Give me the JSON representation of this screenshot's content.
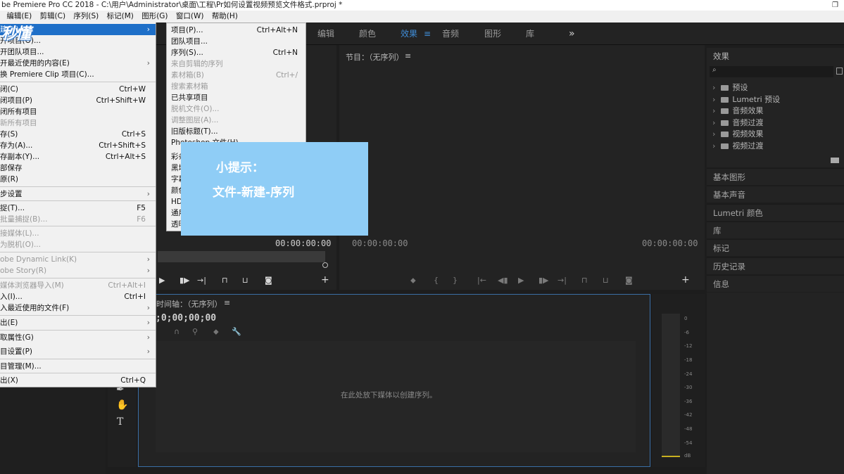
{
  "window": {
    "title": "be Premiere Pro CC 2018 - C:\\用户\\Administrator\\桌面\\工程\\Pr如何设置视频预览文件格式.prproj *",
    "restore_glyph": "❐"
  },
  "menubar": {
    "items": [
      "编辑(E)",
      "剪辑(C)",
      "序列(S)",
      "标记(M)",
      "图形(G)",
      "窗口(W)",
      "帮助(H)"
    ]
  },
  "logo_text": "秒懂",
  "workspaces": {
    "tabs": [
      "编辑",
      "颜色",
      "效果",
      "音频",
      "图形",
      "库"
    ],
    "active": "效果",
    "more_glyph": "»",
    "active_menu_glyph": "≡"
  },
  "file_menu": {
    "items": [
      {
        "label": "建(N)",
        "shortcut": "",
        "arrow": true,
        "disabled": false
      },
      {
        "label": "开项目(O)...",
        "shortcut": "",
        "arrow": false,
        "disabled": false
      },
      {
        "label": "开团队项目...",
        "shortcut": "",
        "arrow": false,
        "disabled": false
      },
      {
        "label": "开最近使用的内容(E)",
        "shortcut": "",
        "arrow": true,
        "disabled": false
      },
      {
        "label": "换 Premiere Clip 项目(C)...",
        "shortcut": "",
        "arrow": false,
        "disabled": false
      },
      {
        "label": "闭(C)",
        "shortcut": "Ctrl+W",
        "arrow": false,
        "disabled": false
      },
      {
        "label": "闭项目(P)",
        "shortcut": "Ctrl+Shift+W",
        "arrow": false,
        "disabled": false
      },
      {
        "label": "闭所有项目",
        "shortcut": "",
        "arrow": false,
        "disabled": false
      },
      {
        "label": "新所有项目",
        "shortcut": "",
        "arrow": false,
        "disabled": true
      },
      {
        "label": "存(S)",
        "shortcut": "Ctrl+S",
        "arrow": false,
        "disabled": false
      },
      {
        "label": "存为(A)...",
        "shortcut": "Ctrl+Shift+S",
        "arrow": false,
        "disabled": false
      },
      {
        "label": "存副本(Y)...",
        "shortcut": "Ctrl+Alt+S",
        "arrow": false,
        "disabled": false
      },
      {
        "label": "部保存",
        "shortcut": "",
        "arrow": false,
        "disabled": false
      },
      {
        "label": "原(R)",
        "shortcut": "",
        "arrow": false,
        "disabled": false
      },
      {
        "label": "步设置",
        "shortcut": "",
        "arrow": true,
        "disabled": false
      },
      {
        "label": "捉(T)...",
        "shortcut": "F5",
        "arrow": false,
        "disabled": false
      },
      {
        "label": "批量捕捉(B)...",
        "shortcut": "F6",
        "arrow": false,
        "disabled": true
      },
      {
        "label": "接媒体(L)...",
        "shortcut": "",
        "arrow": false,
        "disabled": true
      },
      {
        "label": "为脱机(O)...",
        "shortcut": "",
        "arrow": false,
        "disabled": true
      },
      {
        "label": "obe Dynamic Link(K)",
        "shortcut": "",
        "arrow": true,
        "disabled": true
      },
      {
        "label": "obe Story(R)",
        "shortcut": "",
        "arrow": true,
        "disabled": true
      },
      {
        "label": "媒体浏览器导入(M)",
        "shortcut": "Ctrl+Alt+I",
        "arrow": false,
        "disabled": true
      },
      {
        "label": "入(I)...",
        "shortcut": "Ctrl+I",
        "arrow": false,
        "disabled": false
      },
      {
        "label": "入最近使用的文件(F)",
        "shortcut": "",
        "arrow": true,
        "disabled": false
      },
      {
        "label": "出(E)",
        "shortcut": "",
        "arrow": true,
        "disabled": false
      },
      {
        "label": "取属性(G)",
        "shortcut": "",
        "arrow": true,
        "disabled": false
      },
      {
        "label": "目设置(P)",
        "shortcut": "",
        "arrow": true,
        "disabled": false
      },
      {
        "label": "目管理(M)...",
        "shortcut": "",
        "arrow": false,
        "disabled": false
      },
      {
        "label": "出(X)",
        "shortcut": "Ctrl+Q",
        "arrow": false,
        "disabled": false
      }
    ]
  },
  "new_submenu": {
    "items": [
      {
        "label": "项目(P)...",
        "shortcut": "Ctrl+Alt+N",
        "disabled": false
      },
      {
        "label": "团队项目...",
        "shortcut": "",
        "disabled": false
      },
      {
        "label": "序列(S)...",
        "shortcut": "Ctrl+N",
        "disabled": false
      },
      {
        "label": "来自剪辑的序列",
        "shortcut": "",
        "disabled": true
      },
      {
        "label": "素材箱(B)",
        "shortcut": "Ctrl+/",
        "disabled": true
      },
      {
        "label": "搜索素材箱",
        "shortcut": "",
        "disabled": true
      },
      {
        "label": "已共享项目",
        "shortcut": "",
        "disabled": false
      },
      {
        "label": "脱机文件(O)...",
        "shortcut": "",
        "disabled": true
      },
      {
        "label": "调整图层(A)...",
        "shortcut": "",
        "disabled": true
      },
      {
        "label": "旧版标题(T)...",
        "shortcut": "",
        "disabled": false
      },
      {
        "label": "Photoshop 文件(H)...",
        "shortcut": "",
        "disabled": false
      },
      {
        "label": "彩条",
        "shortcut": "",
        "disabled": false
      },
      {
        "label": "黑场",
        "shortcut": "",
        "disabled": false
      },
      {
        "label": "字幕",
        "shortcut": "",
        "disabled": false
      },
      {
        "label": "颜色",
        "shortcut": "",
        "disabled": false
      },
      {
        "label": "HD",
        "shortcut": "",
        "disabled": false
      },
      {
        "label": "通用",
        "shortcut": "",
        "disabled": false
      },
      {
        "label": "透明",
        "shortcut": "",
        "disabled": false
      }
    ]
  },
  "tip": {
    "line1": "小提示：",
    "line2": "文件-新建-序列"
  },
  "source_monitor": {
    "timecode": "00:00:00:00"
  },
  "program_monitor": {
    "title": "节目：（无序列）",
    "menu_glyph": "≡",
    "timecode_left": "00:00:00:00",
    "timecode_right": "00:00:00:00"
  },
  "effects_panel": {
    "title": "效果",
    "search_placeholder": "",
    "items": [
      "预设",
      "Lumetri 预设",
      "音频效果",
      "音频过渡",
      "视频效果",
      "视频过渡"
    ]
  },
  "right_panels": [
    "基本图形",
    "基本声音",
    "Lumetri 颜色",
    "库",
    "标记",
    "历史记录",
    "信息"
  ],
  "timeline": {
    "title": "时间轴：（无序列）",
    "menu_glyph": "≡",
    "timecode": ";0;00;00;00",
    "drop_hint": "在此处放下媒体以创建序列。"
  },
  "audio_meter": {
    "labels": [
      "0",
      "-6",
      "-12",
      "-18",
      "-24",
      "-30",
      "-36",
      "-42",
      "-48",
      "-54",
      "dB"
    ]
  },
  "colors": {
    "accent": "#3f8cd6",
    "tip_bg": "#8fcdf6",
    "panel_bg": "#232323",
    "app_bg": "#1d1d1d",
    "timeline_border": "#3a6ea5"
  }
}
